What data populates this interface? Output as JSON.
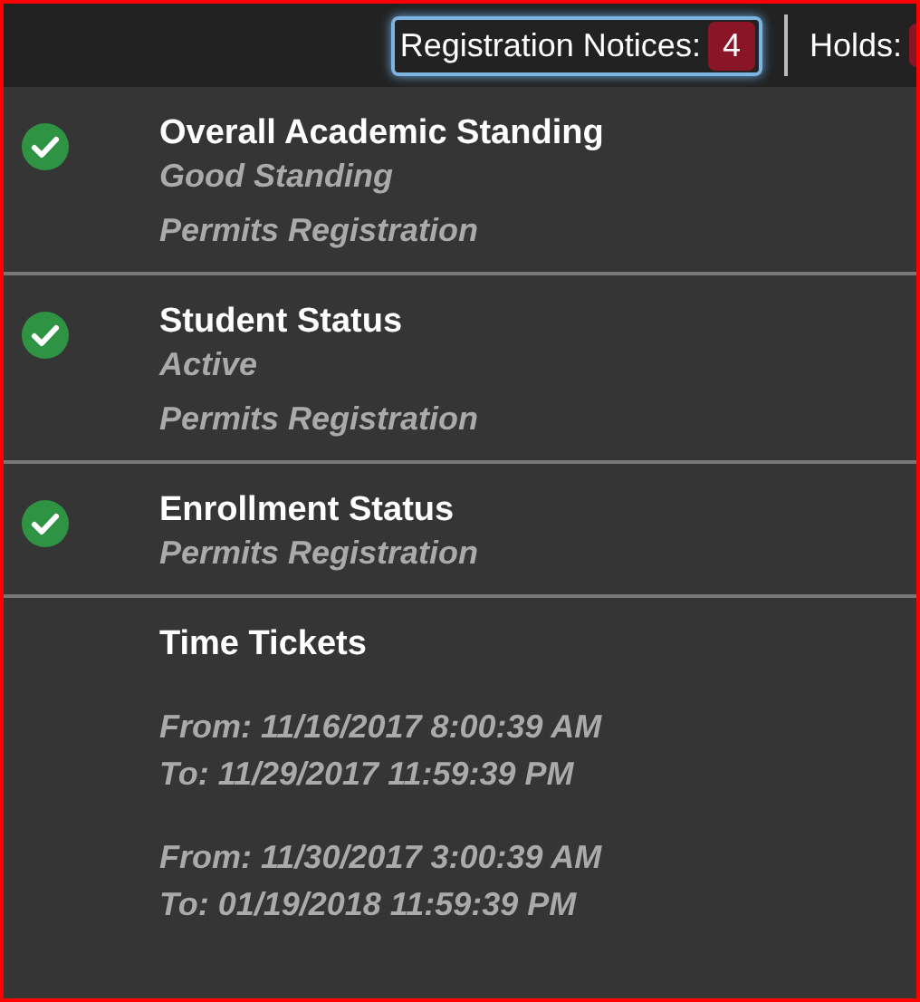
{
  "top_bar": {
    "notices": {
      "label": "Registration Notices:",
      "count": "4",
      "focused": true
    },
    "holds": {
      "label": "Holds:"
    }
  },
  "sections": [
    {
      "kind": "status",
      "title": "Overall Academic Standing",
      "lines": [
        "Good Standing",
        "Permits Registration"
      ]
    },
    {
      "kind": "status",
      "title": "Student Status",
      "lines": [
        "Active",
        "Permits Registration"
      ]
    },
    {
      "kind": "status",
      "title": "Enrollment Status",
      "lines": [
        "Permits Registration"
      ]
    },
    {
      "kind": "tickets",
      "title": "Time Tickets",
      "tickets": [
        {
          "from": "From: 11/16/2017 8:00:39 AM",
          "to": "To: 11/29/2017 11:59:39 PM"
        },
        {
          "from": "From: 11/30/2017 3:00:39 AM",
          "to": "To: 01/19/2018 11:59:39 PM"
        }
      ]
    }
  ]
}
